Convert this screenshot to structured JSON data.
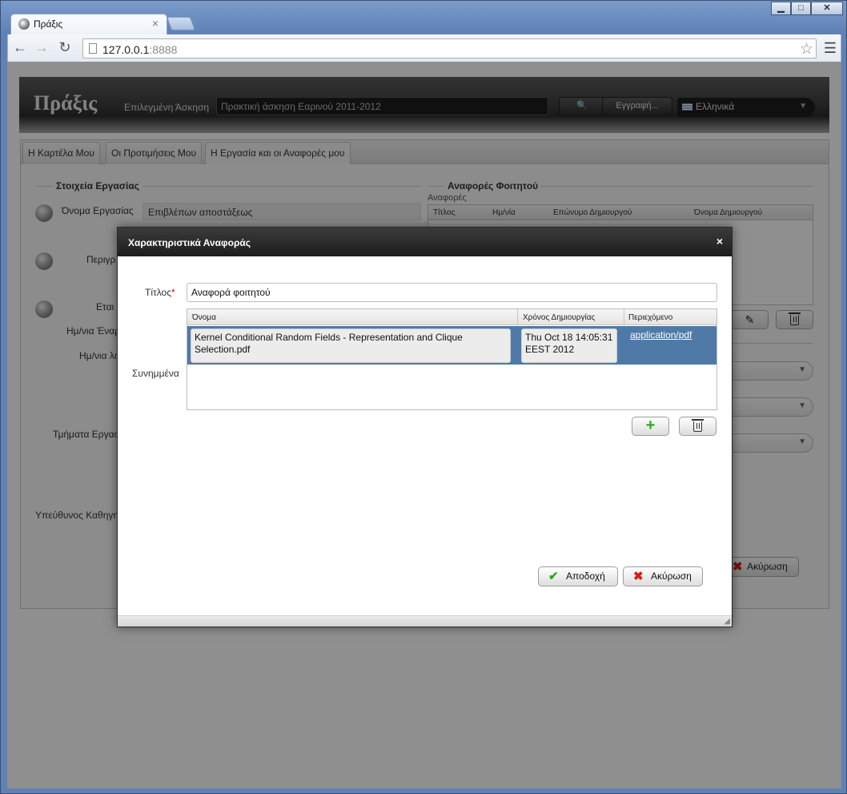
{
  "browser": {
    "tab_title": "Πράξις",
    "url_host": "127.0.0.1",
    "url_port": ":8888",
    "window_controls": [
      "minimize",
      "maximize",
      "close"
    ]
  },
  "header": {
    "brand": "Πράξις",
    "selected_label": "Επιλεγμένη Άσκηση",
    "selected_value": "Πρακτική άσκηση Εαρινού 2011-2012",
    "search_icon": "search-icon",
    "register_label": "Εγγραφή...",
    "language": "Ελληνικά"
  },
  "tabs": [
    {
      "label": "Η Καρτέλα Μου"
    },
    {
      "label": "Οι Προτιμήσεις Μου"
    },
    {
      "label": "Η Εργασία και οι Αναφορές μου"
    }
  ],
  "work": {
    "legend": "Στοιχεία Εργασίας",
    "name_label": "Όνομα Εργασίας",
    "name_value": "Επιβλέπων αποστάξεως",
    "description_label": "Περιγρ",
    "company_label": "Εται",
    "start_date_label": "Ημ/νια Έναρ",
    "end_date_label": "Ημ/νια λή",
    "departments_label": "Τμήματα Εργασ",
    "supervisor_label": "Υπεύθυνος Καθηγη"
  },
  "reports": {
    "legend": "Αναφορές Φοιτητού",
    "grid_label": "Αναφορές",
    "columns": [
      "Τίτλος",
      "Ημ/νία",
      "Επώνυμο Δημιουργού",
      "Όνομα Δημιουργού"
    ]
  },
  "background_cancel": "Ακύρωση",
  "dialog": {
    "title": "Χαρακτηριστικά Αναφοράς",
    "close_glyph": "×",
    "title_label": "Τίτλος",
    "required_mark": "*",
    "title_value": "Αναφορά φοιτητού",
    "attachments_label": "Συνημμένα",
    "columns": [
      "Όνομα",
      "Χρόνος Δημιουργίας",
      "Περιεχόμενο"
    ],
    "rows": [
      {
        "name": "Kernel Conditional Random Fields - Representation and Clique Selection.pdf",
        "created": "Thu Oct 18 14:05:31 EEST 2012",
        "content": "application/pdf"
      }
    ],
    "accept_label": "Αποδοχή",
    "cancel_label": "Ακύρωση"
  },
  "colors": {
    "selected_row": "#4f7aa8",
    "add_green": "#2eaa1e",
    "cancel_red": "#d0201c"
  }
}
